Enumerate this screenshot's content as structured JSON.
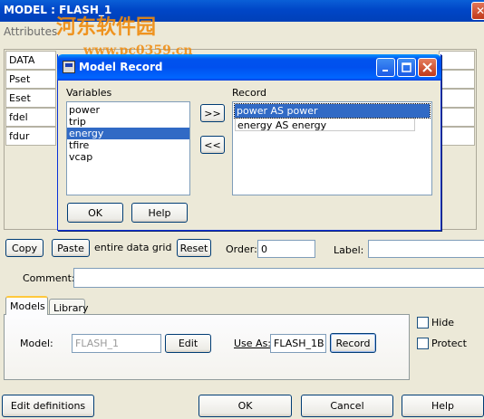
{
  "window": {
    "title": "MODEL : FLASH_1",
    "close_glyph": "✕",
    "watermark": "河东软件园",
    "watermark_url": "www.pc0359.cn"
  },
  "attributes_tab": {
    "label": "Attributes"
  },
  "grid": {
    "rows": [
      "DATA",
      "Pset",
      "Eset",
      "fdel",
      "fdur"
    ]
  },
  "modal": {
    "title": "Model Record",
    "icon": "app-icon",
    "variables_label": "Variables",
    "record_label": "Record",
    "variables": [
      "power",
      "trip",
      "energy",
      "tfire",
      "vcap"
    ],
    "selected_variable": "energy",
    "record_items": [
      "power AS power",
      "energy AS energy"
    ],
    "selected_record": "power AS power",
    "add_label": ">>",
    "remove_label": "<<",
    "ok_label": "OK",
    "help_label": "Help",
    "minimize_icon": "minimize-icon",
    "maximize_icon": "maximize-icon",
    "close_icon": "close-icon"
  },
  "toolbar": {
    "copy_label": "Copy",
    "paste_label": "Paste",
    "paste_suffix": "entire data grid",
    "reset_label": "Reset",
    "order_label": "Order:",
    "order_value": "0",
    "label_label": "Label:",
    "label_value": ""
  },
  "comment": {
    "label": "Comment:",
    "value": ""
  },
  "tabs": [
    {
      "label": "Models",
      "active": true
    },
    {
      "label": "Library",
      "active": false
    }
  ],
  "models_panel": {
    "model_label": "Model:",
    "model_value": "FLASH_1",
    "edit_label": "Edit",
    "use_as_label": "Use As:",
    "use_as_value": "FLASH_1B",
    "record_label": "Record"
  },
  "options": {
    "hide_label": "Hide",
    "hide_checked": false,
    "protect_label": "Protect",
    "protect_checked": false
  },
  "bottom": {
    "edit_definitions_label": "Edit definitions",
    "ok_label": "OK",
    "cancel_label": "Cancel",
    "help_label": "Help"
  }
}
